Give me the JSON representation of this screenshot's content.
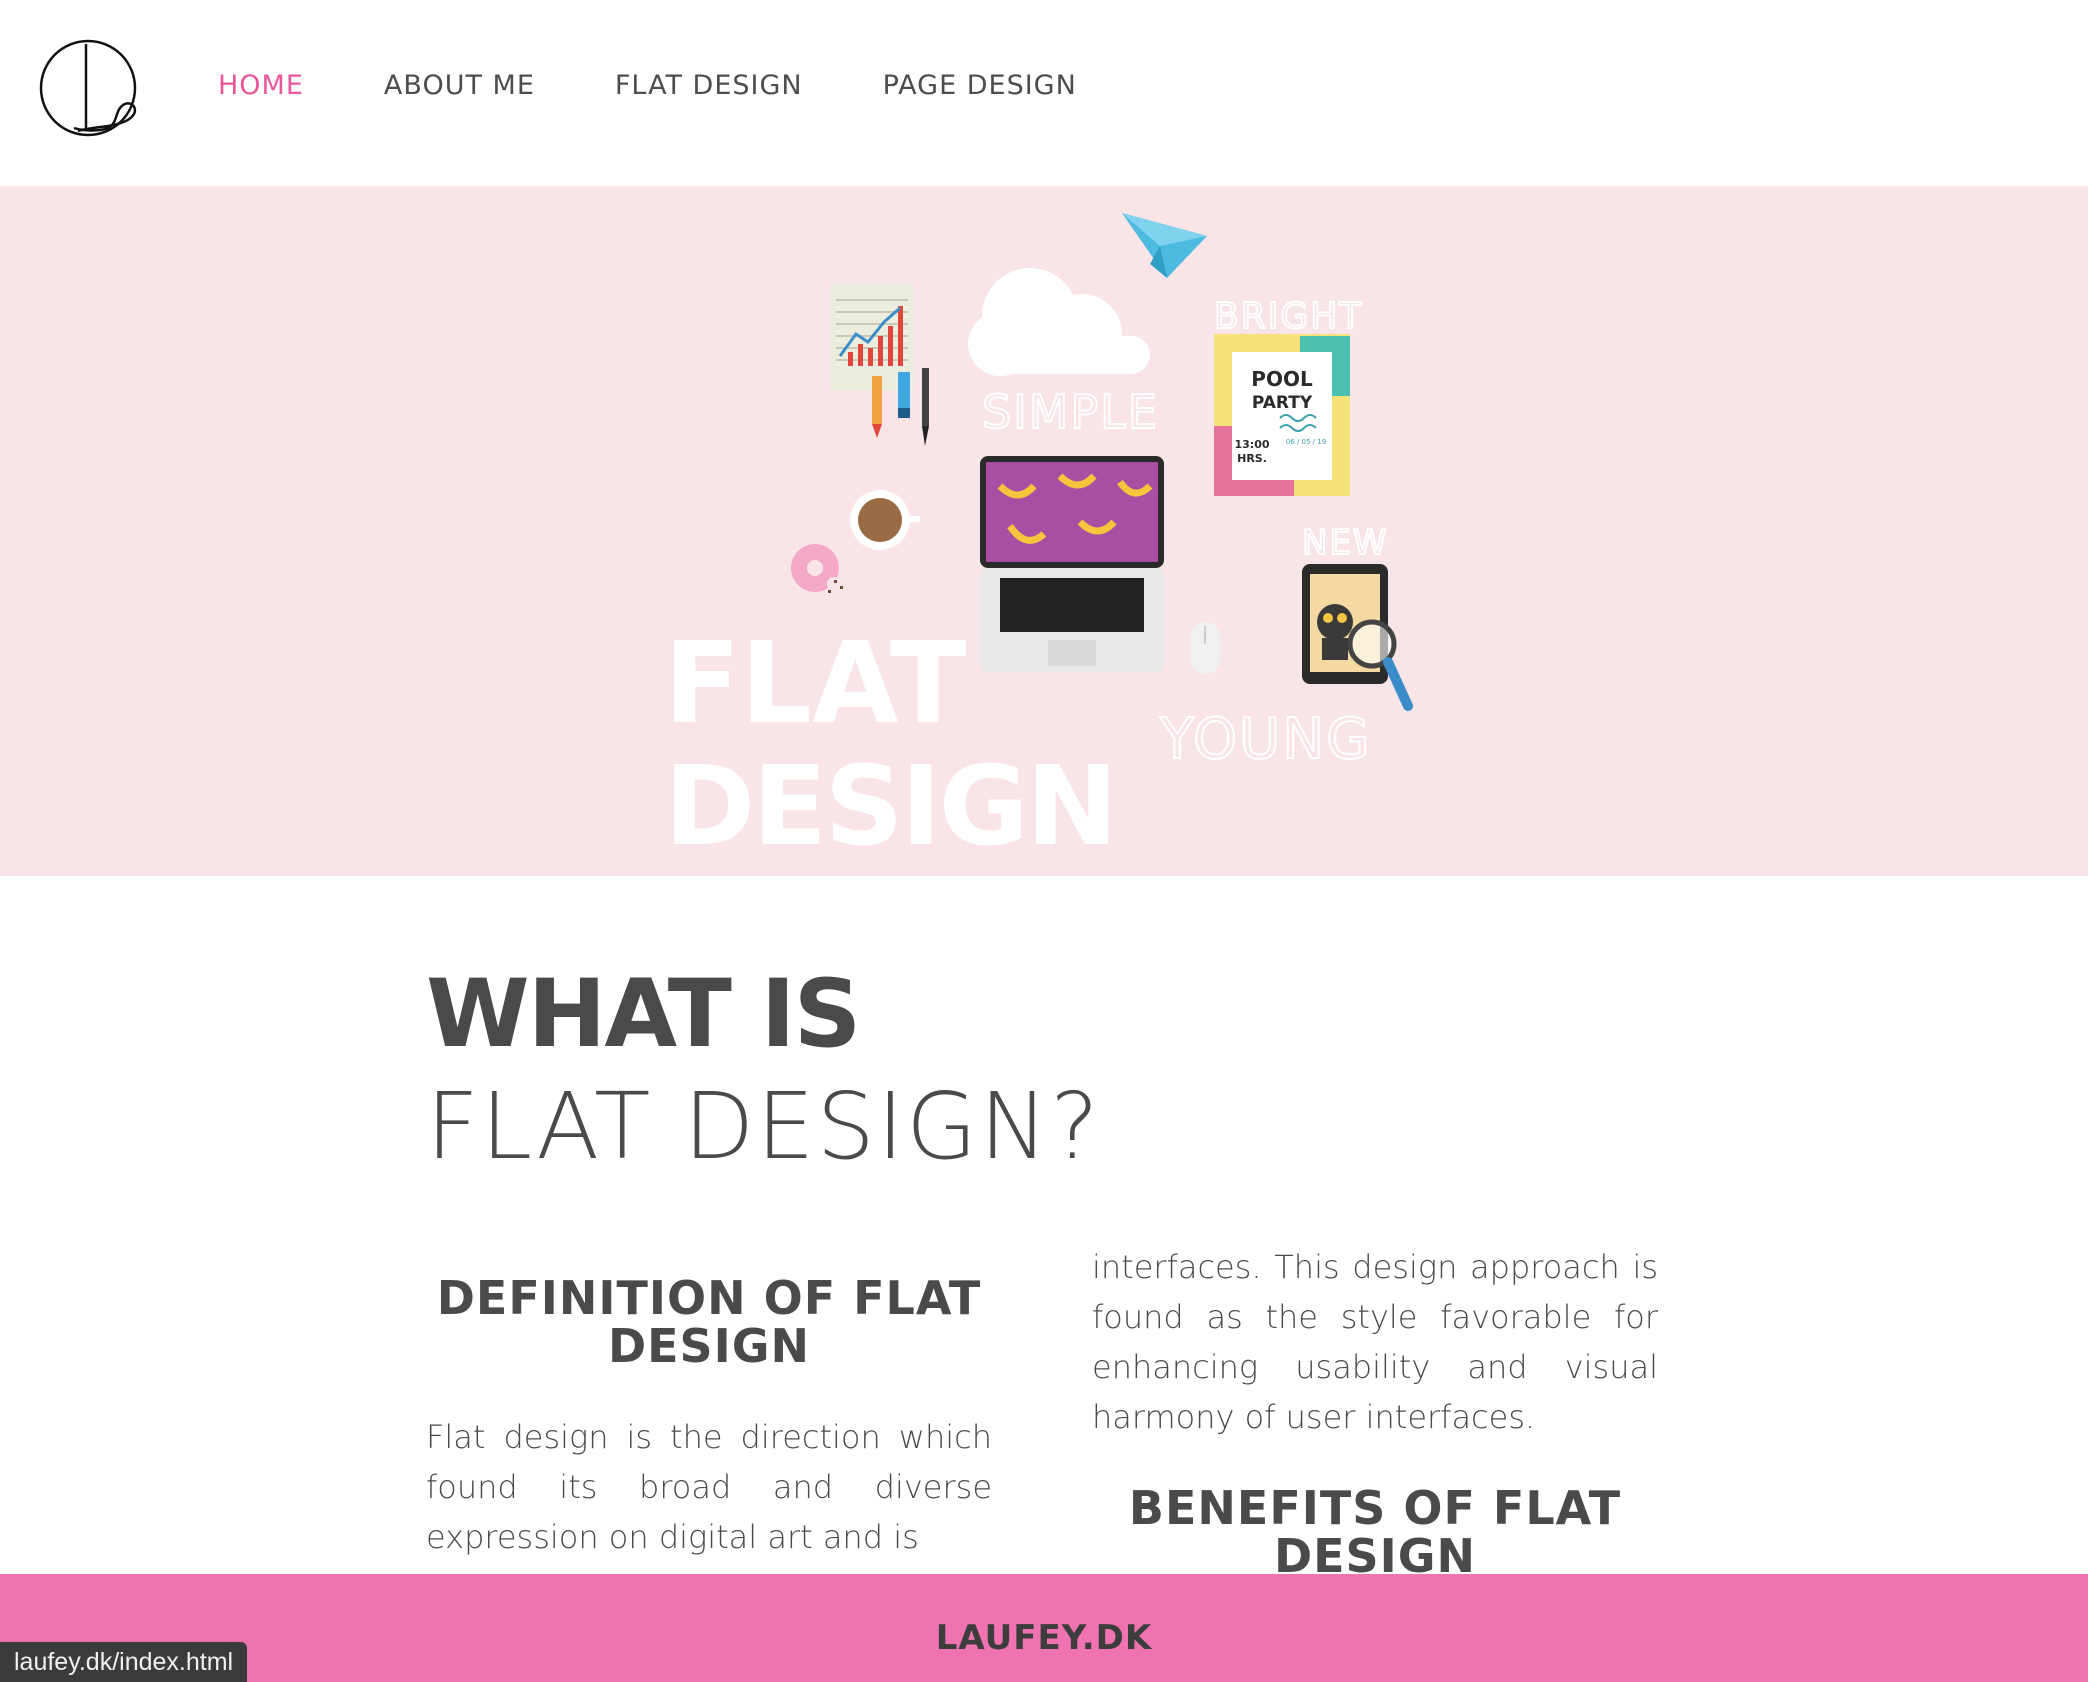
{
  "nav": {
    "items": [
      {
        "label": "HOME",
        "active": true
      },
      {
        "label": "ABOUT ME",
        "active": false
      },
      {
        "label": "FLAT DESIGN",
        "active": false
      },
      {
        "label": "PAGE DESIGN",
        "active": false
      }
    ],
    "active_color": "#e8579b"
  },
  "hero": {
    "background": "#f9e4e8",
    "title_line1": "FLAT",
    "title_line2": "DESIGN",
    "words": {
      "simple": "SIMPLE",
      "bright": "BRIGHT",
      "new": "NEW",
      "young": "YOUNG"
    },
    "poster": {
      "line1": "POOL",
      "line2": "PARTY",
      "time": "13:00",
      "hrs": "HRS.",
      "date": "06 / 05 / 19"
    },
    "illustration_icons": [
      "paper-plane-icon",
      "cloud-icon",
      "chart-notepad-icon",
      "pencils-icon",
      "coffee-cup-icon",
      "donut-icon",
      "laptop-icon",
      "mouse-icon",
      "tablet-icon",
      "magnifier-icon"
    ]
  },
  "main": {
    "title_bold": "WHAT IS",
    "title_light": "FLAT DESIGN?",
    "definition_heading": "DEFINITION OF FLAT DESIGN",
    "definition_text": "Flat design is the direction which found its broad and diverse expression on digital art and is",
    "definition_text_cont": "interfaces. This design approach is found as the style favorable for enhancing usability and visual harmony of user interfaces.",
    "benefits_heading": "BENEFITS OF FLAT DESIGN"
  },
  "footer": {
    "text": "LAUFEY.DK",
    "background": "#ef73b0"
  },
  "statusbar": {
    "url": "laufey.dk/index.html"
  }
}
